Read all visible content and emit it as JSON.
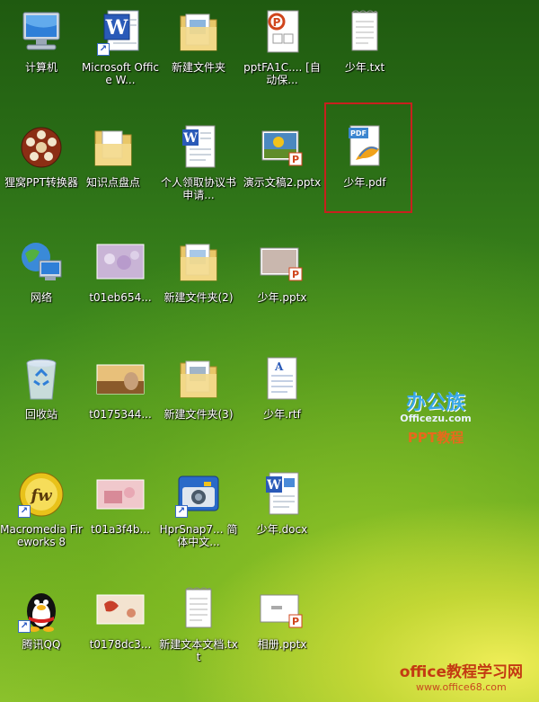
{
  "desktop": {
    "icons": [
      {
        "label": "计算机",
        "icon": "computer-icon"
      },
      {
        "label": "Microsoft Office W...",
        "icon": "word-icon"
      },
      {
        "label": "新建文件夹",
        "icon": "folder-icon"
      },
      {
        "label": "pptFA1C.... [自动保...",
        "icon": "ppt-doc-icon"
      },
      {
        "label": "少年.txt",
        "icon": "text-file-icon"
      },
      {
        "label": "狸窝PPT转换器",
        "icon": "film-reel-icon"
      },
      {
        "label": "知识点盘点",
        "icon": "folder-icon"
      },
      {
        "label": "个人领取协议书申请...",
        "icon": "word-doc-icon"
      },
      {
        "label": "演示文稿2.pptx",
        "icon": "pptx-image-icon"
      },
      {
        "label": "少年.pdf",
        "icon": "pdf-icon"
      },
      {
        "label": "网络",
        "icon": "network-globe-icon"
      },
      {
        "label": "t01eb654...",
        "icon": "photo-icon"
      },
      {
        "label": "新建文件夹(2)",
        "icon": "folder-icon"
      },
      {
        "label": "少年.pptx",
        "icon": "pptx-image-icon"
      },
      {
        "label": "回收站",
        "icon": "recycle-bin-icon"
      },
      {
        "label": "t0175344...",
        "icon": "photo-icon"
      },
      {
        "label": "新建文件夹(3)",
        "icon": "folder-icon"
      },
      {
        "label": "少年.rtf",
        "icon": "rtf-file-icon"
      },
      {
        "label": "Macromedia Fireworks 8",
        "icon": "fireworks-icon"
      },
      {
        "label": "t01a3f4b...",
        "icon": "photo-icon"
      },
      {
        "label": "HprSnap7... 简体中文...",
        "icon": "camera-icon"
      },
      {
        "label": "少年.docx",
        "icon": "word-doc-icon"
      },
      {
        "label": "腾讯QQ",
        "icon": "qq-penguin-icon"
      },
      {
        "label": "t0178dc3...",
        "icon": "photo-icon"
      },
      {
        "label": "新建文本文档.txt",
        "icon": "text-file-icon"
      },
      {
        "label": "相册.pptx",
        "icon": "pptx-image-icon"
      }
    ]
  },
  "branding": {
    "logo_text": "办公族",
    "logo_sub": "Officezu.com",
    "logo_tag": "PPT教程",
    "watermark_main": "office教程学习网",
    "watermark_url": "www.office68.com"
  },
  "colors": {
    "selection_border": "#c8201e",
    "label_text": "#ffffff"
  }
}
